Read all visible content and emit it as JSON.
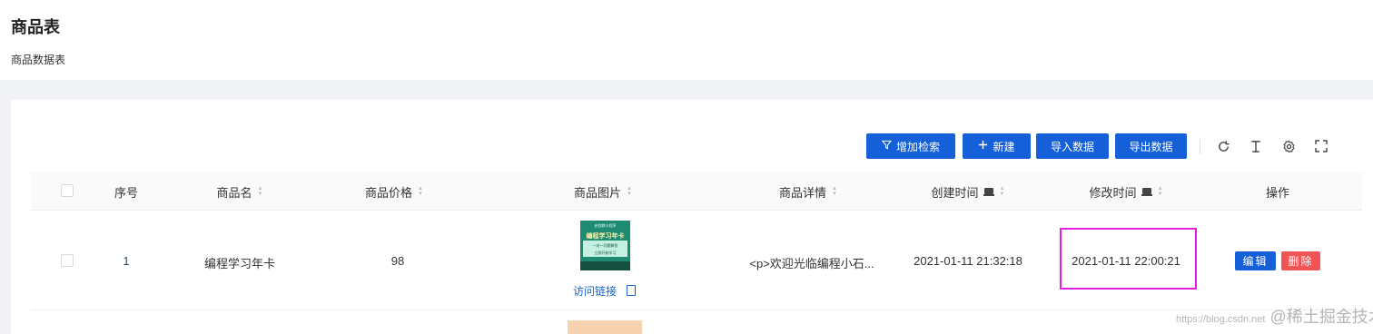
{
  "page": {
    "title": "商品表",
    "subtitle": "商品数据表"
  },
  "toolbar": {
    "add_search": "增加检索",
    "new": "新建",
    "import": "导入数据",
    "export": "导出数据",
    "icons": [
      "refresh-icon",
      "text-height-icon",
      "settings-icon",
      "fullscreen-icon"
    ]
  },
  "table": {
    "columns": {
      "index": "序号",
      "name": "商品名",
      "price": "商品价格",
      "image": "商品图片",
      "detail": "商品详情",
      "created": "创建时间",
      "modified": "修改时间",
      "actions": "操作"
    },
    "rows": [
      {
        "index": "1",
        "name": "编程学习年卡",
        "price": "98",
        "image_link": "访问链接",
        "image_text": {
          "top": "启程教小程序",
          "title": "编程学习年卡",
          "line1": "一对一问题解答",
          "line2": "立即开始学习"
        },
        "detail": "<p>欢迎光临编程小石...",
        "created": "2021-01-11 21:32:18",
        "modified": "2021-01-11 22:00:21",
        "edit": "编辑",
        "delete": "删除"
      }
    ]
  },
  "watermark": {
    "small": "https://blog.csdn.net",
    "main": "@稀土掘金技术社区"
  },
  "colors": {
    "primary": "#1560d8",
    "danger": "#f05454",
    "highlight": "#e020e0"
  }
}
